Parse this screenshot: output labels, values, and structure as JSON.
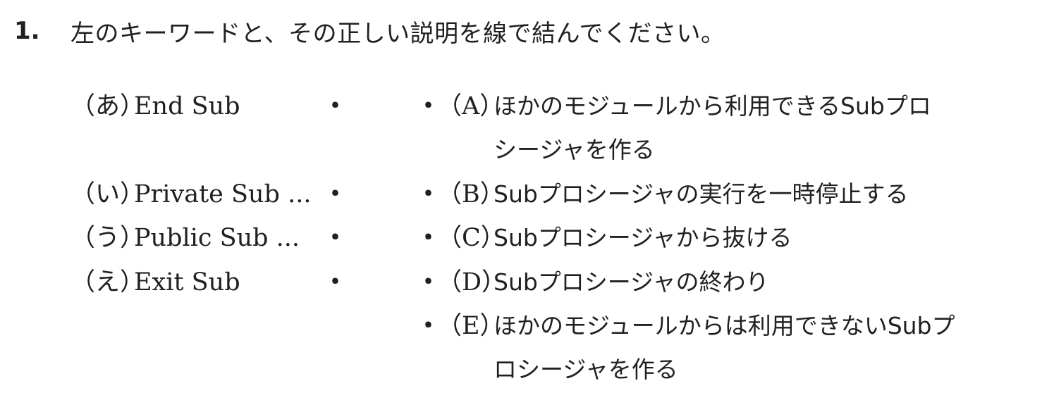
{
  "question": {
    "number": "1.",
    "text": "左のキーワードと、その正しい説明を線で結んでください。"
  },
  "bullet": "・",
  "keywords": [
    {
      "label": "（あ）",
      "text": "End Sub"
    },
    {
      "label": "（い）",
      "text": "Private Sub ..."
    },
    {
      "label": "（う）",
      "text": "Public Sub ..."
    },
    {
      "label": "（え）",
      "text": "Exit Sub"
    }
  ],
  "definitions": [
    {
      "label": "（A）",
      "text": "ほかのモジュールから利用できるSubプロ",
      "continuation": "シージャを作る"
    },
    {
      "label": "（B）",
      "text": "Subプロシージャの実行を一時停止する",
      "continuation": ""
    },
    {
      "label": "（C）",
      "text": "Subプロシージャから抜ける",
      "continuation": ""
    },
    {
      "label": "（D）",
      "text": "Subプロシージャの終わり",
      "continuation": ""
    },
    {
      "label": "（E）",
      "text": "ほかのモジュールからは利用できないSubプ",
      "continuation": "ロシージャを作る"
    }
  ]
}
